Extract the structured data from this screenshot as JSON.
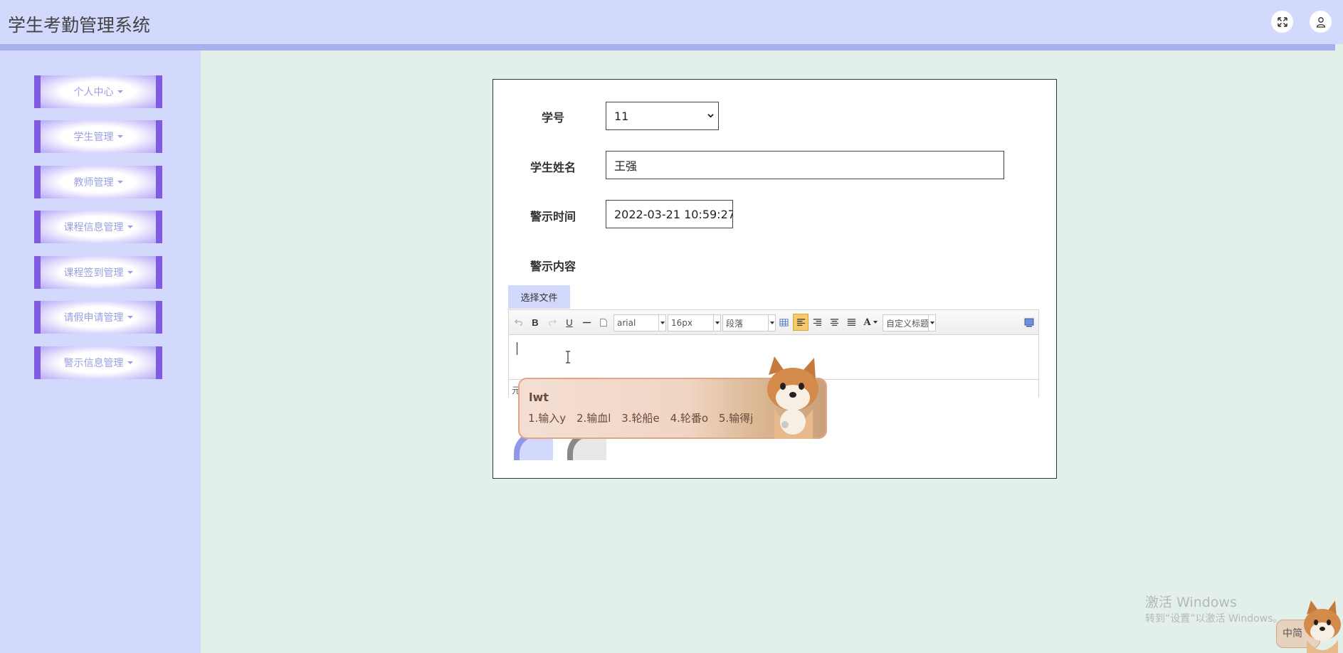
{
  "app": {
    "title": "学生考勤管理系统"
  },
  "header": {
    "fullscreen_icon": "expand-icon",
    "user_icon": "user-icon"
  },
  "sidebar": {
    "items": [
      {
        "label": "个人中心"
      },
      {
        "label": "学生管理"
      },
      {
        "label": "教师管理"
      },
      {
        "label": "课程信息管理"
      },
      {
        "label": "课程签到管理"
      },
      {
        "label": "请假申请管理"
      },
      {
        "label": "警示信息管理"
      }
    ]
  },
  "form": {
    "student_id": {
      "label": "学号",
      "value": "11"
    },
    "student_name": {
      "label": "学生姓名",
      "value": "王强"
    },
    "warn_time": {
      "label": "警示时间",
      "value": "2022-03-21 10:59:27"
    },
    "warn_content": {
      "label": "警示内容"
    },
    "file_button": "选择文件"
  },
  "editor": {
    "font_family": "arial",
    "font_size": "16px",
    "paragraph": "段落",
    "custom_title": "自定义标题",
    "bold": "B",
    "underline": "U",
    "font_color": "A",
    "status_text": "元"
  },
  "ime": {
    "composition": "lwt",
    "candidates": [
      "1.输入y",
      "2.输血l",
      "3.轮船e",
      "4.轮番o",
      "5.输得j"
    ]
  },
  "watermark": {
    "line1": "激活 Windows",
    "line2": "转到“设置”以激活 Windows。"
  },
  "tray": {
    "ime_mode": "中简"
  },
  "colors": {
    "header_bg": "#d3d9fc",
    "nav_border": "#7e5be0",
    "content_bg": "#e3f0ea"
  }
}
